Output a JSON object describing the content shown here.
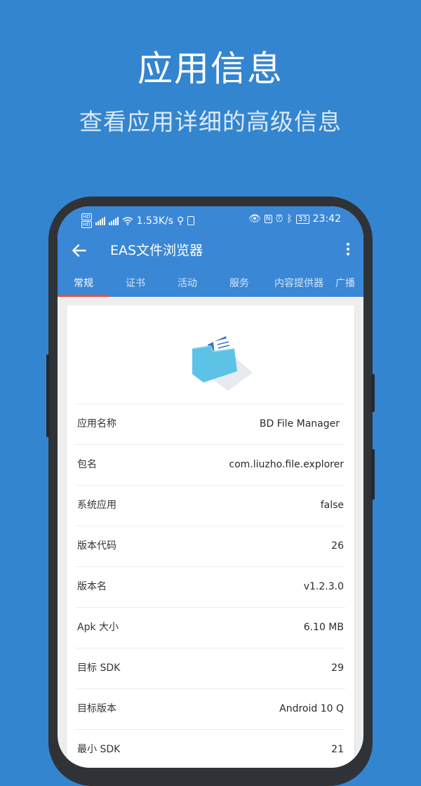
{
  "headline": "应用信息",
  "subline": "查看应用详细的高级信息",
  "status_bar": {
    "speed": "1.53K/s",
    "battery": "33",
    "time": "23:42"
  },
  "toolbar": {
    "title": "EAS文件浏览器"
  },
  "tabs": [
    {
      "label": "常规",
      "active": true
    },
    {
      "label": "证书"
    },
    {
      "label": "活动"
    },
    {
      "label": "服务"
    },
    {
      "label": "内容提供器"
    },
    {
      "label": "广播"
    }
  ],
  "info_rows": [
    {
      "key": "应用名称",
      "value": "BD File Manager"
    },
    {
      "key": "包名",
      "value": "com.liuzho.file.explorer"
    },
    {
      "key": "系统应用",
      "value": "false"
    },
    {
      "key": "版本代码",
      "value": "26"
    },
    {
      "key": "版本名",
      "value": "v1.2.3.0"
    },
    {
      "key": "Apk 大小",
      "value": "6.10 MB"
    },
    {
      "key": "目标 SDK",
      "value": "29"
    },
    {
      "key": "目标版本",
      "value": "Android 10 Q"
    },
    {
      "key": "最小 SDK",
      "value": "21"
    }
  ],
  "colors": {
    "background": "#3485cf",
    "appbar": "#3a87d6",
    "tab_indicator": "#e84f3d"
  }
}
